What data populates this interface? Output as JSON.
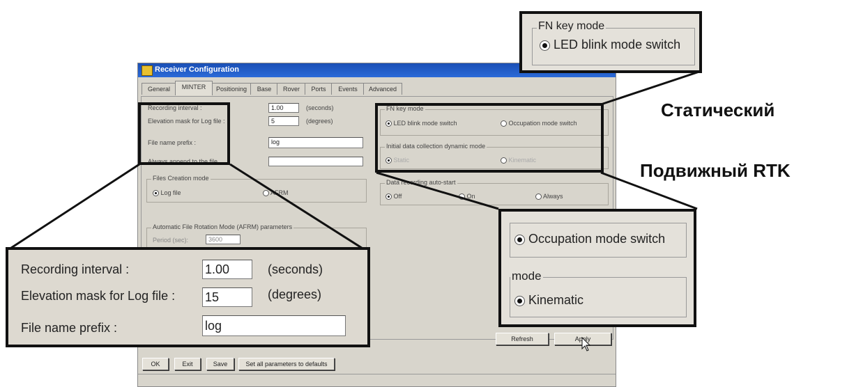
{
  "dialog": {
    "title": "Receiver Configuration",
    "tabs": [
      "General",
      "MINTER",
      "Positioning",
      "Base",
      "Rover",
      "Ports",
      "Events",
      "Advanced"
    ],
    "recording": {
      "interval_label": "Recording interval :",
      "interval_value": "1.00",
      "interval_unit": "(seconds)",
      "mask_label": "Elevation mask for Log file :",
      "mask_value": "5",
      "mask_unit": "(degrees)",
      "prefix_label": "File name prefix :",
      "prefix_value": "log",
      "append_label": "Always append to the file",
      "append_value": ""
    },
    "files_creation": {
      "title": "Files Creation mode",
      "opt1": "Log file",
      "opt2": "AFRM"
    },
    "afrm": {
      "title": "Automatic File Rotation Mode (AFRM) parameters",
      "period_label": "Period (sec):",
      "period_value": "3600"
    },
    "fn_key": {
      "title": "FN key mode",
      "opt1": "LED blink mode switch",
      "opt2": "Occupation mode switch"
    },
    "initial_mode": {
      "title": "Initial data collection dynamic mode",
      "opt1": "Static",
      "opt2": "Kinematic"
    },
    "auto_start": {
      "title": "Data recording auto-start",
      "opt1": "Off",
      "opt2": "On",
      "opt3": "Always"
    },
    "buttons": {
      "refresh": "Refresh",
      "apply": "Apply",
      "ok": "OK",
      "exit": "Exit",
      "save": "Save",
      "defaults": "Set all parameters to defaults"
    }
  },
  "callouts": {
    "top_right": {
      "title": "FN key mode",
      "option": "LED blink mode switch"
    },
    "bottom_left": {
      "interval_label": "Recording interval :",
      "interval_value": "1.00",
      "interval_unit": "(seconds)",
      "mask_label": "Elevation mask for Log file :",
      "mask_value": "15",
      "mask_unit": "(degrees)",
      "prefix_label": "File name prefix :",
      "prefix_value": "log"
    },
    "right": {
      "occupation": "Occupation mode switch",
      "mode_title": "mode",
      "kinematic": "Kinematic"
    }
  },
  "side_labels": {
    "static": "Статический",
    "rtk": "Подвижный RTK"
  }
}
